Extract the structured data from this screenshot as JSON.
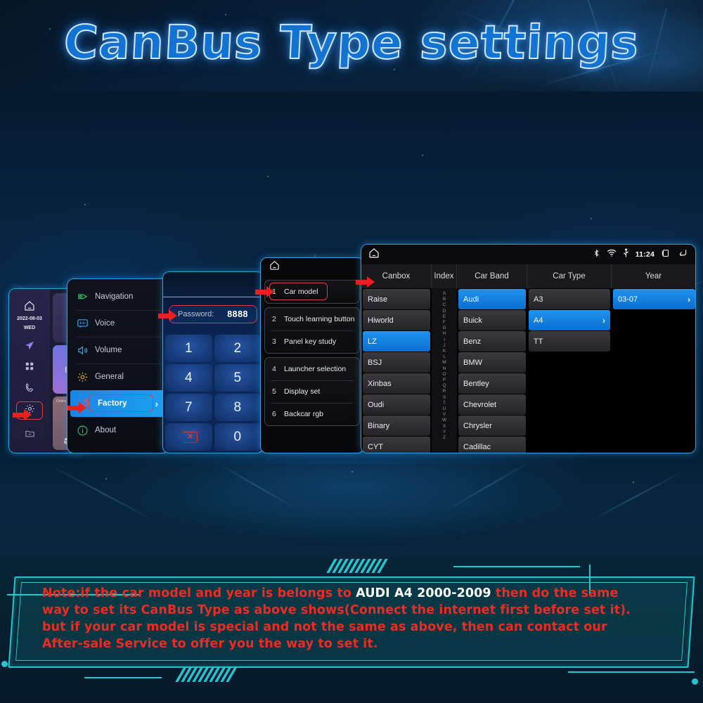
{
  "title": "CanBus Type settings",
  "home_panel": {
    "date": "2022-08-03",
    "weekday": "WED",
    "icons": [
      "home-icon",
      "navigation-arrow-icon",
      "apps-grid-icon",
      "phone-icon",
      "gear-icon",
      "folder-icon"
    ],
    "widget_label": "Online"
  },
  "settings_panel": {
    "items": [
      {
        "label": "Navigation",
        "icon": "navigation-pin-icon",
        "color": "#2fbf6a"
      },
      {
        "label": "Voice",
        "icon": "voice-bubble-icon",
        "color": "#3aa0ea"
      },
      {
        "label": "Volume",
        "icon": "speaker-icon",
        "color": "#3aa0ea"
      },
      {
        "label": "General",
        "icon": "gear-icon",
        "color": "#e8a020"
      },
      {
        "label": "Factory",
        "icon": "wrench-icon",
        "color": "#e8506a"
      },
      {
        "label": "About",
        "icon": "info-icon",
        "color": "#2fbf6a"
      }
    ],
    "active_index": 4,
    "chevron": "›"
  },
  "password_panel": {
    "label": "Password:",
    "value": "8888",
    "keys": [
      "1",
      "2",
      "4",
      "5",
      "7",
      "8",
      "del",
      "0"
    ],
    "delete_icon": "backspace-icon"
  },
  "factory_panel": {
    "home_icon": "home-icon",
    "groups": [
      [
        {
          "num": "1",
          "text": "Car model",
          "highlighted": true
        }
      ],
      [
        {
          "num": "2",
          "text": "Touch learning button"
        },
        {
          "num": "3",
          "text": "Panel key study"
        }
      ],
      [
        {
          "num": "4",
          "text": "Launcher selection"
        },
        {
          "num": "5",
          "text": "Display set"
        },
        {
          "num": "6",
          "text": "Backcar rgb"
        }
      ]
    ]
  },
  "table_panel": {
    "status_bar": {
      "home_icon": "home-icon",
      "bluetooth_icon": "bluetooth-icon",
      "wifi_icon": "wifi-icon",
      "usb_icon": "usb-icon",
      "time": "11:24",
      "recents_icon": "recents-icon",
      "back_icon": "back-icon"
    },
    "columns": [
      "Canbox",
      "Index",
      "Car Band",
      "Car Type",
      "Year"
    ],
    "canbox": [
      {
        "label": "Raise"
      },
      {
        "label": "Hiworld"
      },
      {
        "label": "LZ",
        "selected": true
      },
      {
        "label": "BSJ"
      },
      {
        "label": "Xinbas"
      },
      {
        "label": "Oudi"
      },
      {
        "label": "Binary"
      },
      {
        "label": "CYT"
      }
    ],
    "index": "ABCDEFGHIJKLMNOPQRSTUVWXYZ",
    "car_band": [
      {
        "label": "Audi",
        "selected": true
      },
      {
        "label": "Buick"
      },
      {
        "label": "Benz"
      },
      {
        "label": "BMW"
      },
      {
        "label": "Bentley"
      },
      {
        "label": "Chevrolet"
      },
      {
        "label": "Chrysler"
      },
      {
        "label": "Cadillac"
      }
    ],
    "car_type": [
      {
        "label": "A3"
      },
      {
        "label": "A4",
        "selected": true,
        "chevron": "›"
      },
      {
        "label": "TT"
      }
    ],
    "year": [
      {
        "label": "03-07",
        "selected": true,
        "chevron": "›"
      }
    ]
  },
  "note": {
    "line1_a": "Note:if the car model and year is belongs to ",
    "line1_hl": "AUDI A4 2000-2009",
    "line1_b": " then do the same",
    "line2": "way to set its CanBus Type as above shows(Connect the internet first before set it).",
    "line3": "but if your car model is special and not the same as above, then can contact our",
    "line4": "After-sale Service to offer you the way to set it."
  },
  "colors": {
    "accent_blue": "#1273d2",
    "selection_blue": "#1f93ef",
    "arrow_red": "#e82020",
    "note_red": "#ee2b22",
    "frame_cyan": "#21c6cf"
  }
}
